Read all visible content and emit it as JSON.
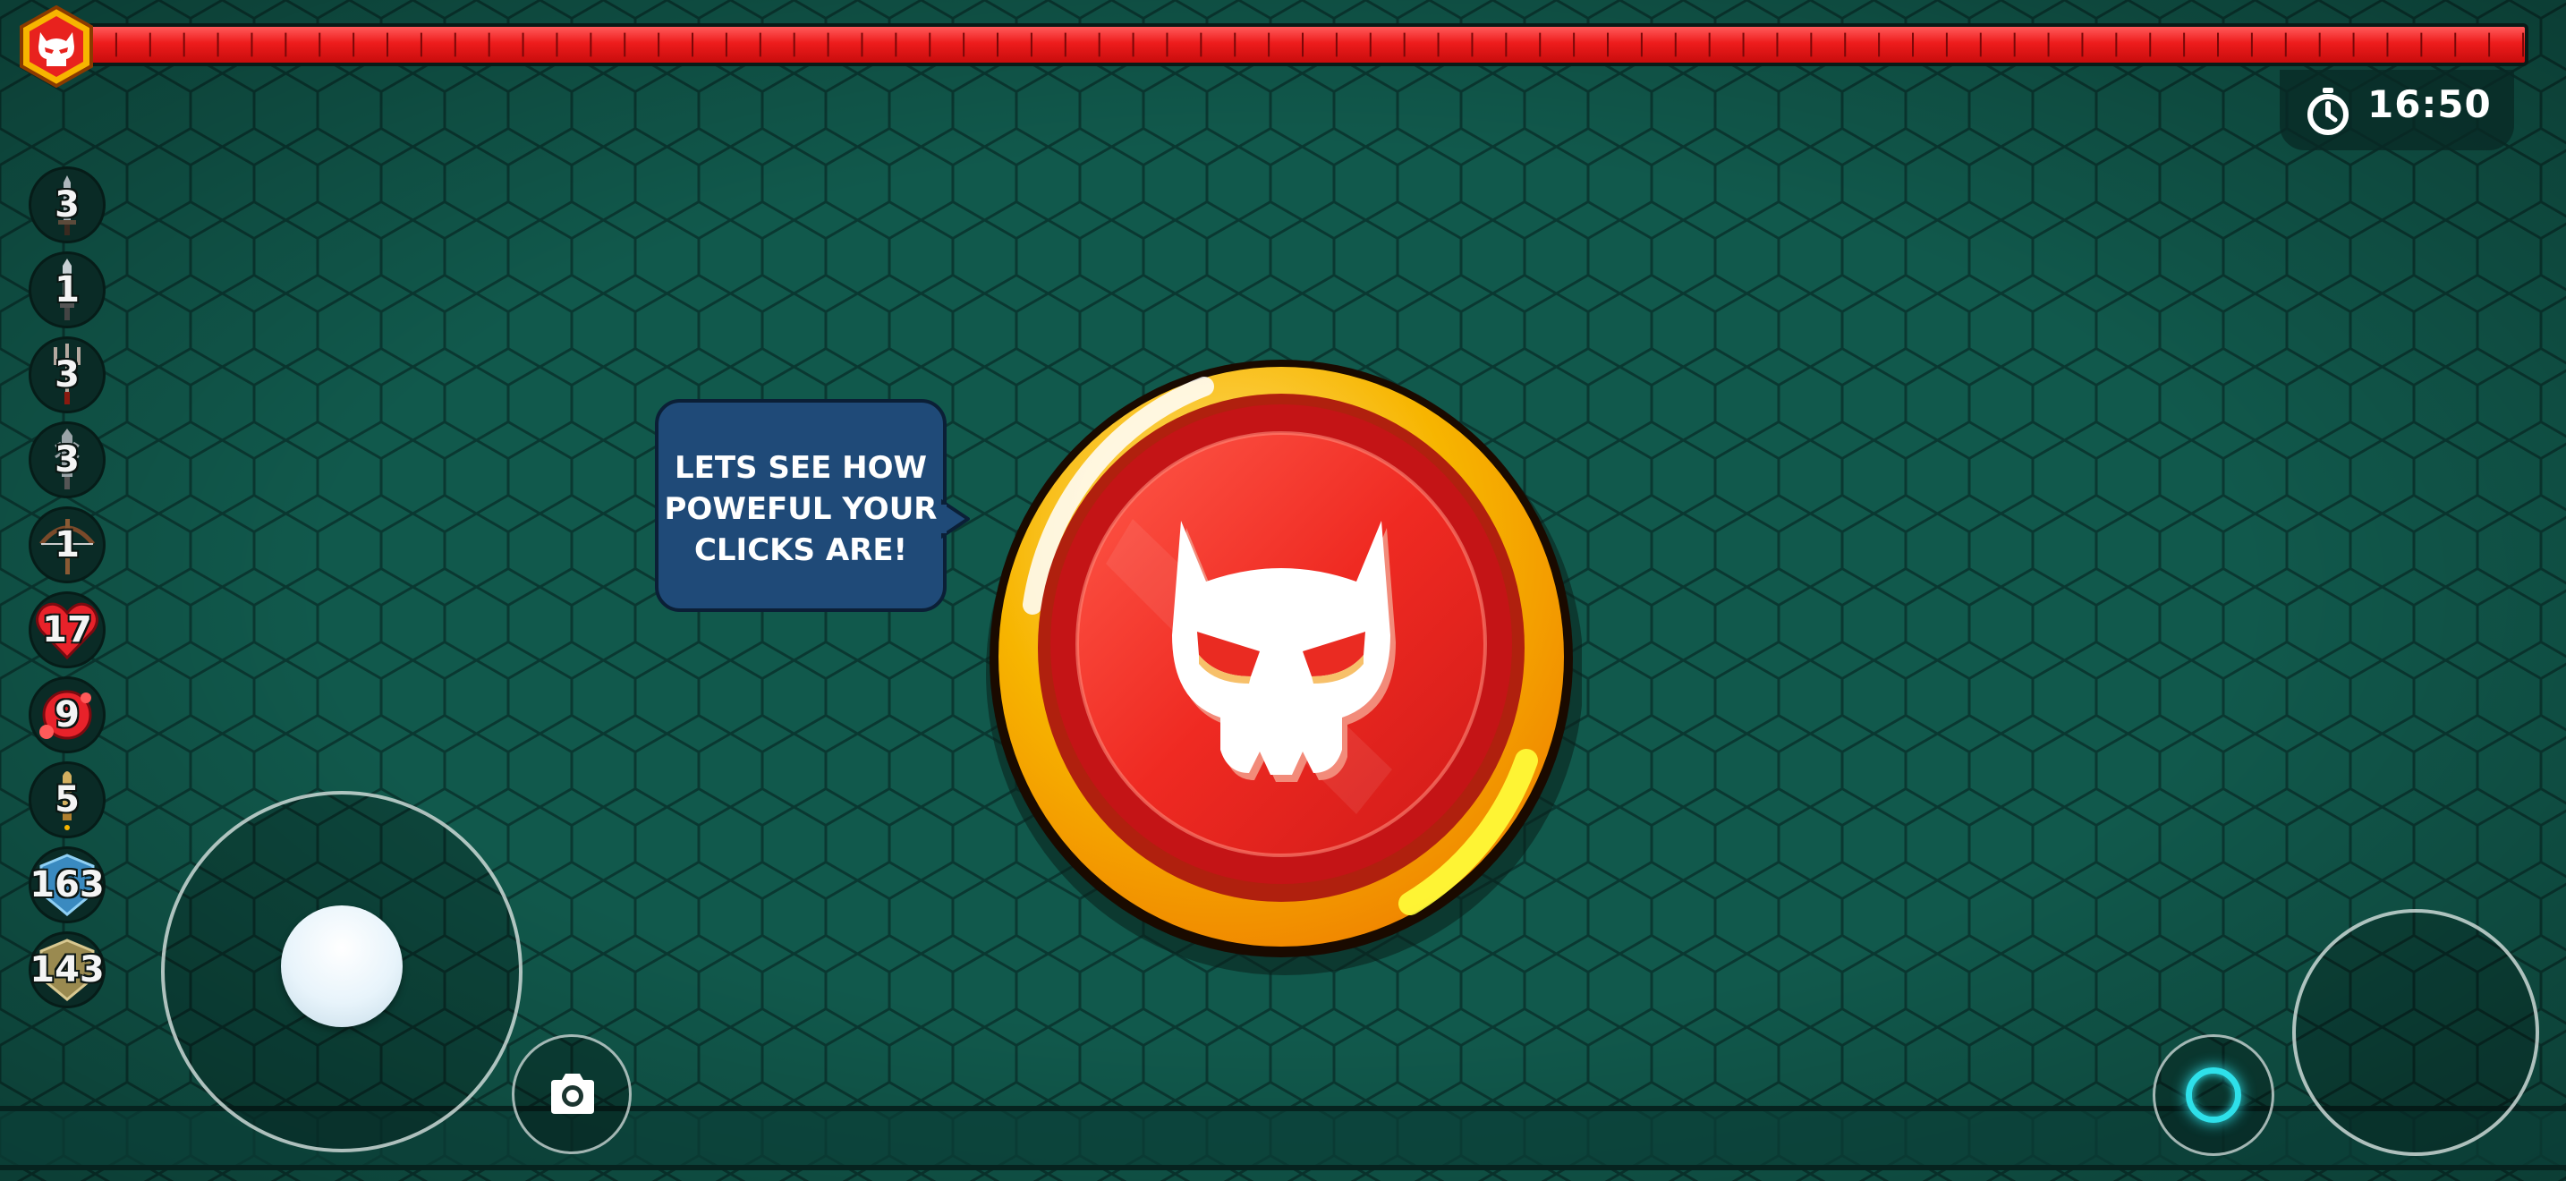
{
  "boss": {
    "icon": "demon-skull-icon",
    "health_percent": 100
  },
  "timer": {
    "icon": "stopwatch-icon",
    "value": "16:50"
  },
  "inventory": [
    {
      "icon": "sword-icon",
      "count": "3"
    },
    {
      "icon": "dagger-icon",
      "count": "1"
    },
    {
      "icon": "trident-icon",
      "count": "3"
    },
    {
      "icon": "spiked-sword-icon",
      "count": "3"
    },
    {
      "icon": "crossbow-icon",
      "count": "1"
    },
    {
      "icon": "heart-icon",
      "count": "17"
    },
    {
      "icon": "red-gem-icon",
      "count": "9"
    },
    {
      "icon": "bullet-icon",
      "count": "5"
    },
    {
      "icon": "blue-shield-icon",
      "count": "163"
    },
    {
      "icon": "gold-shield-icon",
      "count": "143"
    }
  ],
  "speech_bubble": {
    "text": "LETS SEE HOW\nPOWEFUL YOUR\nCLICKS ARE!"
  },
  "boss_button": {
    "icon": "demon-skull-icon"
  },
  "controls": {
    "move_joystick": "joystick",
    "camera_icon": "camera-icon",
    "action_icon": "ring-icon",
    "attack_joystick": "joystick"
  },
  "colors": {
    "background": "#0e4f44",
    "hex_line": "#0a3831",
    "health_bar": "#ee1c1c",
    "bubble": "#1f4a78",
    "button_gold": "#f7b500",
    "button_red": "#e8221e",
    "action_ring": "#2ee0ea"
  }
}
